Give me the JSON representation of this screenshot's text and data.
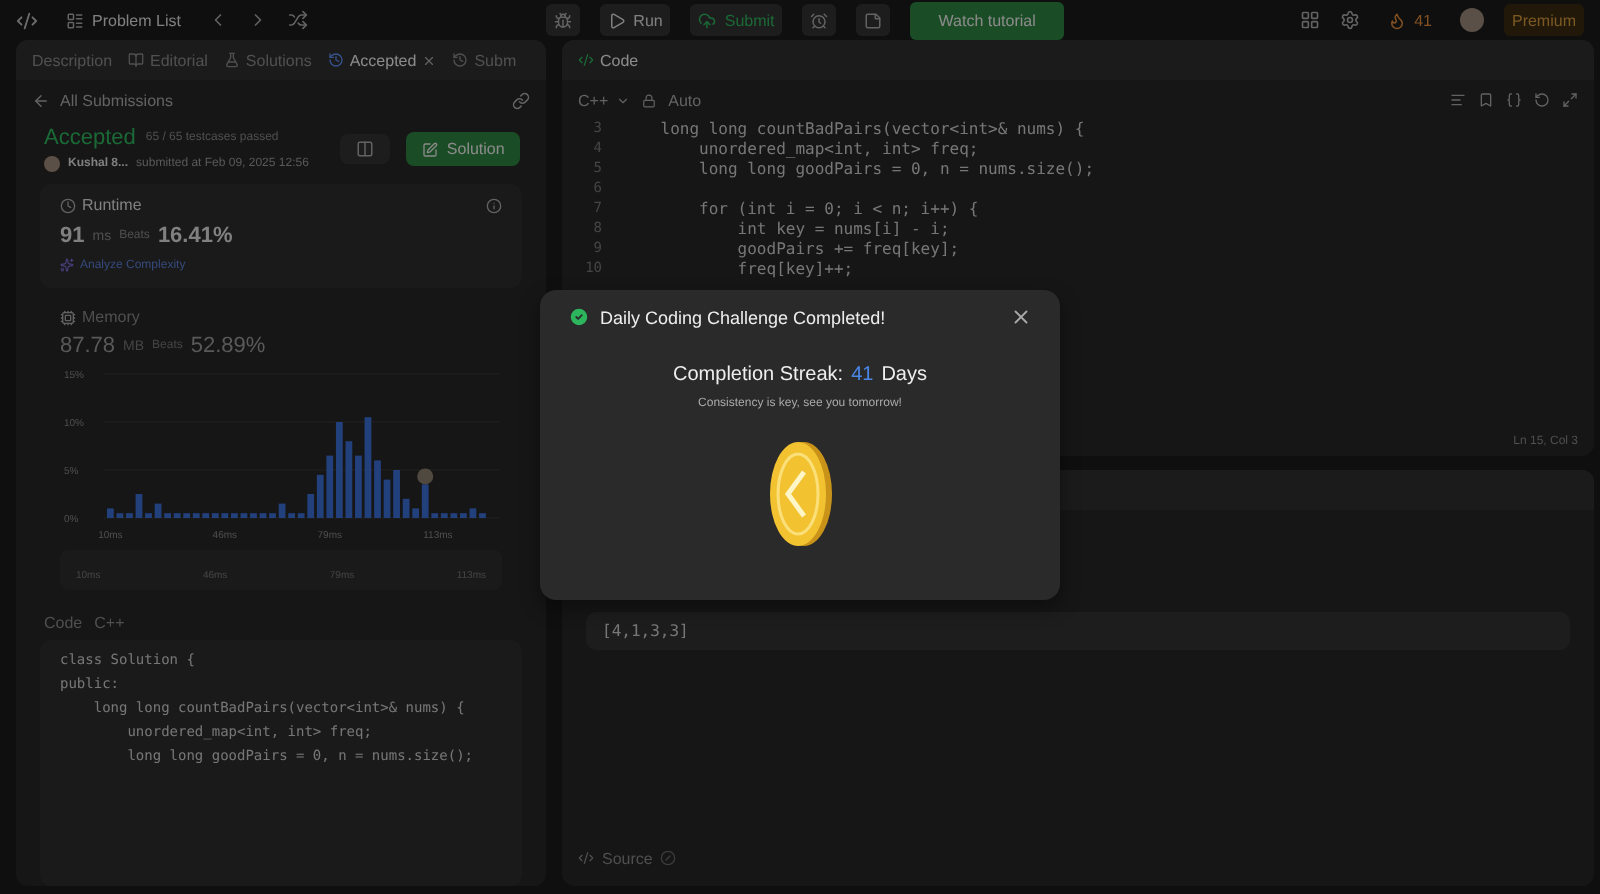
{
  "topbar": {
    "problem_list": "Problem List",
    "run": "Run",
    "submit": "Submit",
    "watch": "Watch tutorial",
    "streak": "41",
    "premium": "Premium"
  },
  "left_panel": {
    "tabs": [
      {
        "label": "Description",
        "selected": false
      },
      {
        "label": "Editorial",
        "selected": false
      },
      {
        "label": "Solutions",
        "selected": false
      },
      {
        "label": "Accepted",
        "selected": true
      },
      {
        "label": "Subm",
        "selected": false
      }
    ],
    "back_link": "All Submissions",
    "status": "Accepted",
    "testcases": "65 / 65 testcases passed",
    "author": "Kushal 8...",
    "submitted": "submitted at Feb 09, 2025 12:56",
    "solution_button": "Solution",
    "runtime": {
      "title": "Runtime",
      "value": "91",
      "unit": "ms",
      "beats_label": "Beats",
      "beats": "16.41%",
      "analyze": "Analyze Complexity"
    },
    "memory": {
      "title": "Memory",
      "value": "87.78",
      "unit": "MB",
      "beats_label": "Beats",
      "beats": "52.89%"
    },
    "chart_data": {
      "type": "bar",
      "x": [
        10,
        13,
        16,
        19,
        22,
        25,
        28,
        31,
        34,
        37,
        40,
        43,
        46,
        49,
        52,
        55,
        58,
        61,
        64,
        67,
        70,
        73,
        76,
        79,
        82,
        85,
        88,
        91,
        94,
        97,
        100,
        103,
        106,
        109,
        112,
        115,
        118,
        121,
        124,
        127
      ],
      "values": [
        1,
        0.5,
        0.5,
        2.5,
        0.5,
        1.5,
        0.5,
        0.5,
        0.5,
        0.5,
        0.5,
        0.5,
        0.5,
        0.5,
        0.5,
        0.5,
        0.5,
        0.5,
        1.5,
        0.5,
        0.5,
        2.5,
        4.5,
        6.5,
        10,
        8,
        6.5,
        10.5,
        6,
        4,
        5,
        2,
        1,
        3.5,
        0.5,
        0.5,
        0.5,
        0.5,
        1,
        0.5
      ],
      "xlim": [
        8,
        130
      ],
      "ylim": [
        0,
        15
      ],
      "yticks": [
        {
          "value": 0,
          "label": "0%"
        },
        {
          "value": 5,
          "label": "5%"
        },
        {
          "value": 10,
          "label": "10%"
        },
        {
          "value": 15,
          "label": "15%"
        }
      ],
      "xticks": [
        {
          "value": 10,
          "label": "10ms"
        },
        {
          "value": 46,
          "label": "46ms"
        },
        {
          "value": 79,
          "label": "79ms"
        },
        {
          "value": 113,
          "label": "113ms"
        }
      ]
    },
    "overview_labels": [
      "10ms",
      "46ms",
      "79ms",
      "113ms"
    ],
    "code_header": "Code",
    "code_lang": "C++",
    "code": [
      "class Solution {",
      "public:",
      "    long long countBadPairs(vector<int>& nums) {",
      "        unordered_map<int, int> freq;",
      "        long long goodPairs = 0, n = nums.size();"
    ]
  },
  "editor": {
    "title": "Code",
    "language": "C++",
    "mode": "Auto",
    "lines": [
      {
        "no": "3",
        "text": "    long long countBadPairs(vector<int>& nums) {"
      },
      {
        "no": "4",
        "text": "        unordered_map<int, int> freq;"
      },
      {
        "no": "5",
        "text": "        long long goodPairs = 0, n = nums.size();"
      },
      {
        "no": "6"
      },
      {
        "no": "7",
        "text": "        for (int i = 0; i < n; i++) {"
      },
      {
        "no": "8",
        "text": "            int key = nums[i] - i;"
      },
      {
        "no": "9",
        "text": "            goodPairs += freq[key];"
      },
      {
        "no": "10",
        "text": "            freq[key]++;"
      }
    ],
    "cursor": "Ln 15, Col 3"
  },
  "testcase": {
    "input": "[4,1,3,3]",
    "source": "Source"
  },
  "modal": {
    "title": "Daily Coding Challenge Completed!",
    "streak_label": "Completion Streak:",
    "streak_value": "41",
    "streak_unit": "Days",
    "message": "Consistency is key, see you tomorrow!"
  }
}
